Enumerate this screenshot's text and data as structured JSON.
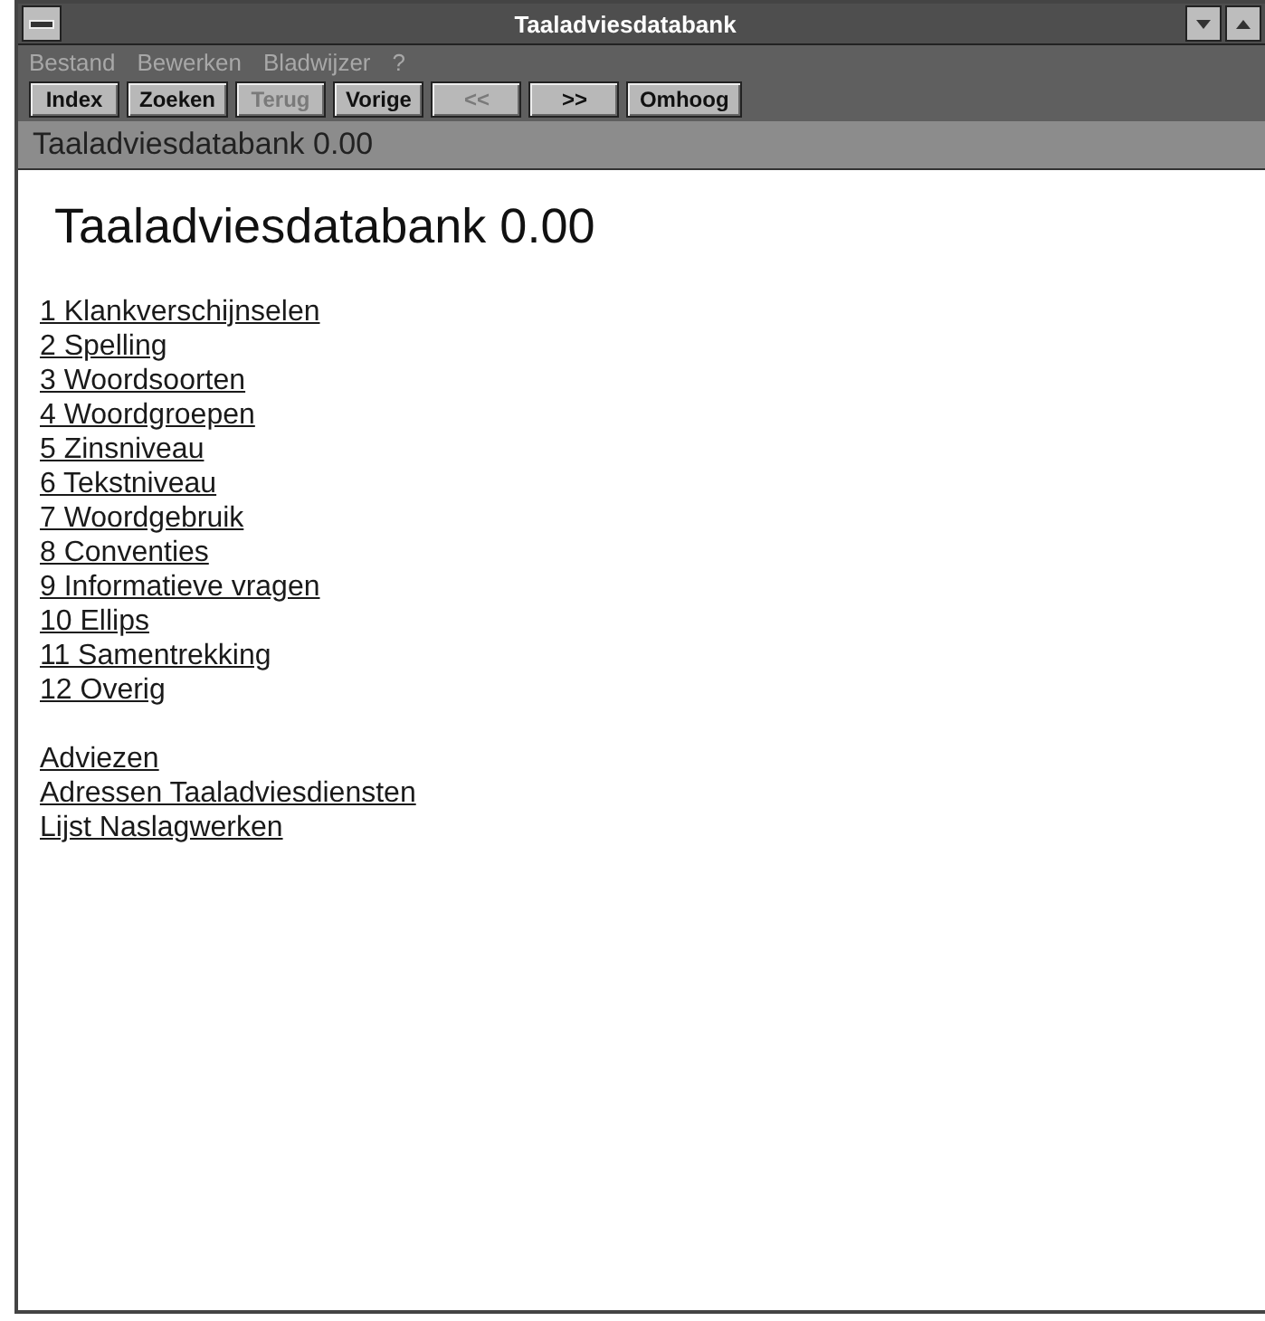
{
  "window": {
    "title": "Taaladviesdatabank"
  },
  "menu": [
    "Bestand",
    "Bewerken",
    "Bladwijzer",
    "?"
  ],
  "buttons": [
    {
      "label": "Index",
      "disabled": false
    },
    {
      "label": "Zoeken",
      "disabled": false
    },
    {
      "label": "Terug",
      "disabled": true
    },
    {
      "label": "Vorige",
      "disabled": false
    },
    {
      "label": "<<",
      "disabled": true
    },
    {
      "label": ">>",
      "disabled": false
    },
    {
      "label": "Omhoog",
      "disabled": false
    }
  ],
  "topic_bar": "Taaladviesdatabank 0.00",
  "content": {
    "title": "Taaladviesdatabank 0.00",
    "topics": [
      "1 Klankverschijnselen",
      "2 Spelling",
      "3 Woordsoorten",
      "4 Woordgroepen",
      "5 Zinsniveau",
      "6 Tekstniveau",
      "7 Woordgebruik",
      "8 Conventies",
      "9 Informatieve vragen",
      "10 Ellips",
      "11 Samentrekking",
      "12 Overig"
    ],
    "links": [
      "Adviezen",
      "Adressen Taaladviesdiensten",
      "Lijst Naslagwerken"
    ]
  }
}
